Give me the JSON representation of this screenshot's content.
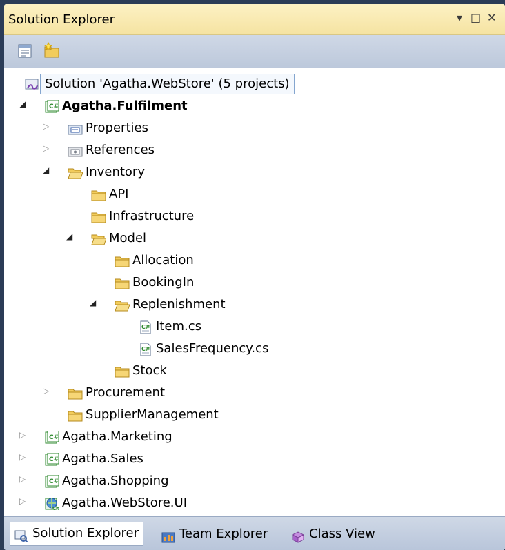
{
  "window": {
    "title": "Solution Explorer",
    "pin_glyph": "▾",
    "maximize_glyph": "□",
    "close_glyph": "✕"
  },
  "toolbar": {
    "buttons": [
      {
        "icon": "properties-icon"
      },
      {
        "icon": "show-all-files-icon"
      }
    ]
  },
  "tree": {
    "items": [
      {
        "label": "Solution 'Agatha.WebStore' (5 projects)",
        "icon": "solution-icon",
        "selected": true
      },
      {
        "label": "Agatha.Fulfilment",
        "icon": "csharp-project-icon",
        "expanded": true,
        "bold": true
      },
      {
        "label": "Properties",
        "icon": "properties-folder-icon",
        "expanded": false
      },
      {
        "label": "References",
        "icon": "references-icon",
        "expanded": false
      },
      {
        "label": "Inventory",
        "icon": "open-folder-icon",
        "expanded": true
      },
      {
        "label": "API",
        "icon": "folder-icon"
      },
      {
        "label": "Infrastructure",
        "icon": "folder-icon"
      },
      {
        "label": "Model",
        "icon": "open-folder-icon",
        "expanded": true
      },
      {
        "label": "Allocation",
        "icon": "folder-icon"
      },
      {
        "label": "BookingIn",
        "icon": "folder-icon"
      },
      {
        "label": "Replenishment",
        "icon": "open-folder-icon",
        "expanded": true
      },
      {
        "label": "Item.cs",
        "icon": "csharp-file-icon"
      },
      {
        "label": "SalesFrequency.cs",
        "icon": "csharp-file-icon"
      },
      {
        "label": "Stock",
        "icon": "folder-icon"
      },
      {
        "label": "Procurement",
        "icon": "folder-icon",
        "expanded": false
      },
      {
        "label": "SupplierManagement",
        "icon": "folder-icon"
      },
      {
        "label": "Agatha.Marketing",
        "icon": "csharp-project-icon",
        "expanded": false
      },
      {
        "label": "Agatha.Sales",
        "icon": "csharp-project-icon",
        "expanded": false
      },
      {
        "label": "Agatha.Shopping",
        "icon": "csharp-project-icon",
        "expanded": false
      },
      {
        "label": "Agatha.WebStore.UI",
        "icon": "web-project-icon",
        "expanded": false
      }
    ]
  },
  "bottom_tabs": [
    {
      "label": "Solution Explorer",
      "icon": "solution-explorer-icon",
      "active": true
    },
    {
      "label": "Team Explorer",
      "icon": "team-explorer-icon"
    },
    {
      "label": "Class View",
      "icon": "class-view-icon"
    }
  ],
  "colors": {
    "title_bar": "#f8e8b0",
    "toolbar": "#c6d1e2",
    "folder": "#f2cc5c",
    "csharp_green": "#2f8a2f",
    "selection_border": "#85a6cf"
  }
}
